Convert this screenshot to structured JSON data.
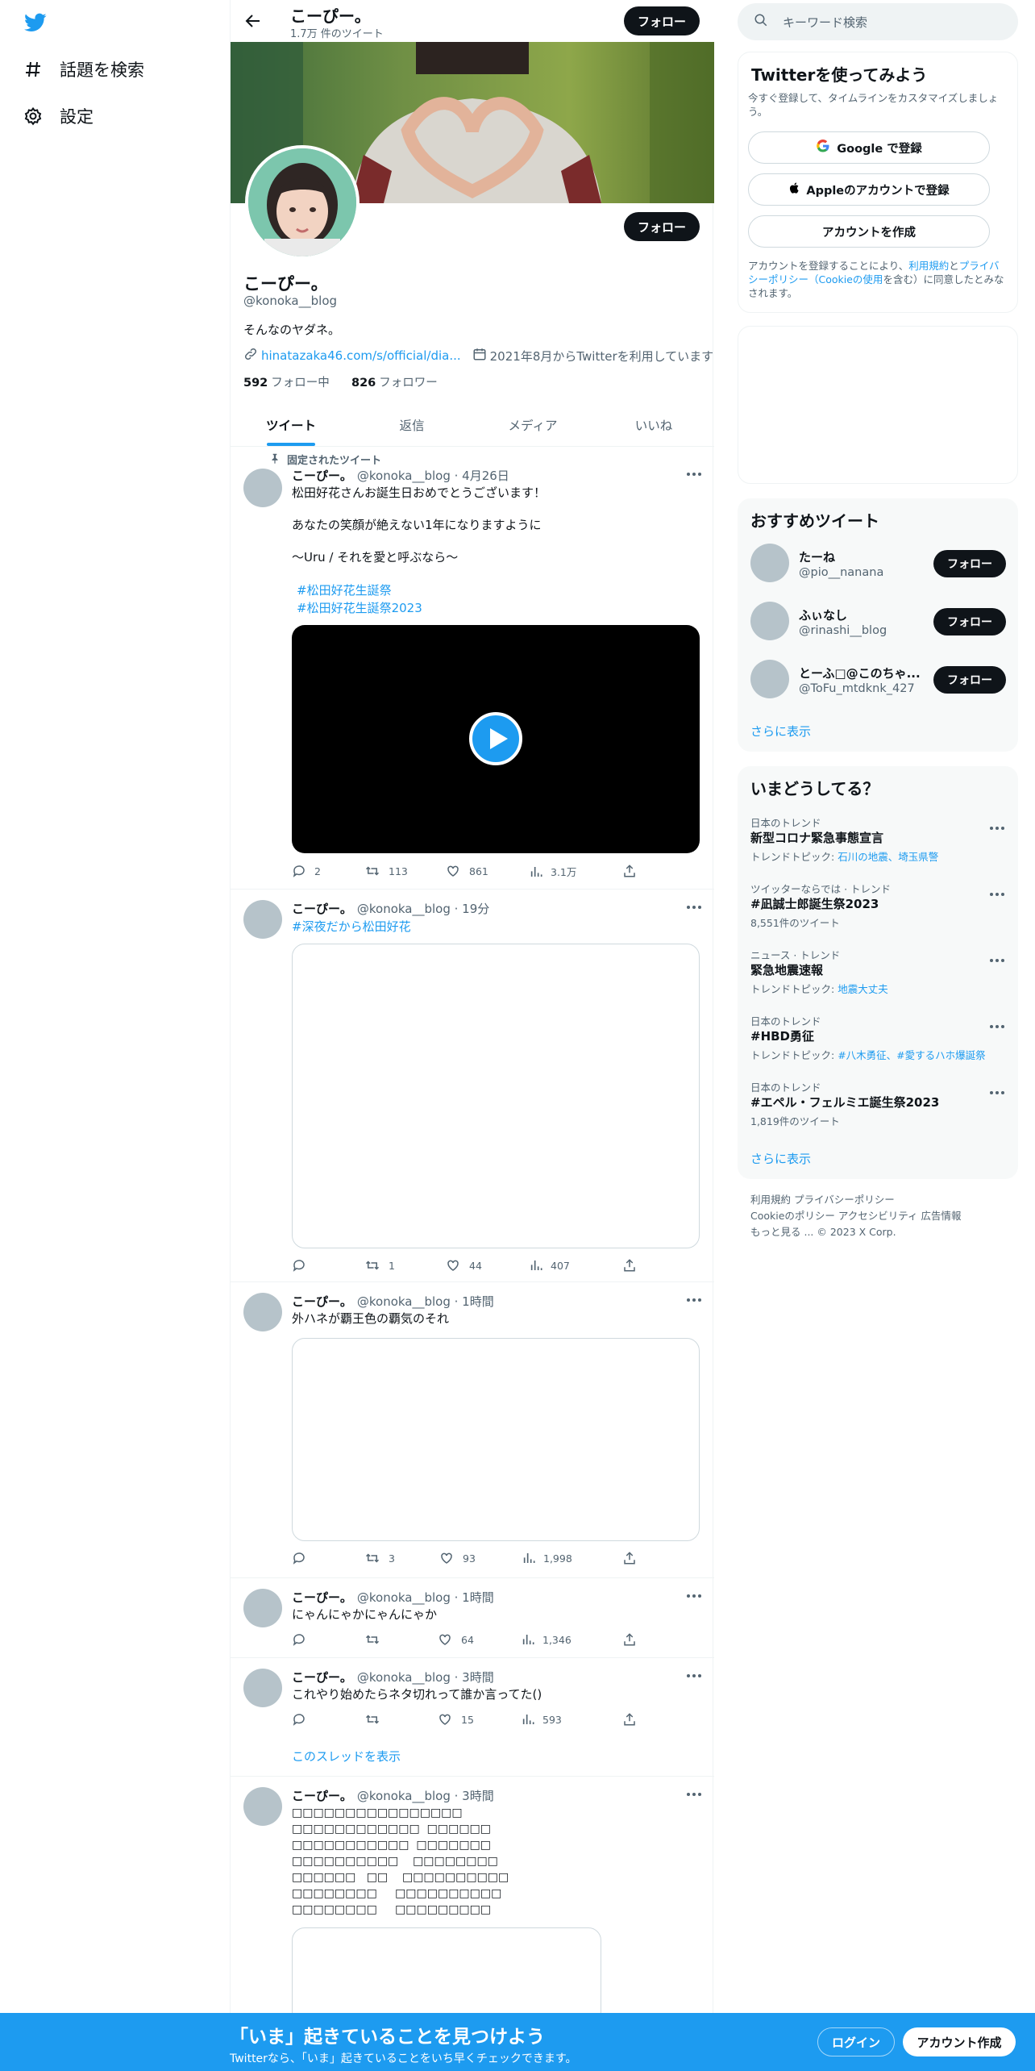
{
  "nav": {
    "logo": "twitter-bird-icon",
    "items": [
      {
        "label": "話題を検索",
        "icon": "hashtag-icon"
      },
      {
        "label": "設定",
        "icon": "gear-icon"
      }
    ]
  },
  "header": {
    "name": "こーぴー。",
    "tweet_count": "1.7万 件のツイート",
    "follow_label": "フォロー"
  },
  "profile": {
    "name": "こーぴー。",
    "handle": "@konoka__blog",
    "bio": "そんなのヤダネ。",
    "link": "hinatazaka46.com/s/official/dia...",
    "joined": "2021年8月からTwitterを利用しています",
    "following_count": "592",
    "following_label": "フォロー中",
    "followers_count": "826",
    "followers_label": "フォロワー",
    "follow_label": "フォロー"
  },
  "tabs": [
    "ツイート",
    "返信",
    "メディア",
    "いいね"
  ],
  "tweets": [
    {
      "pinned_label": "固定されたツイート",
      "name": "こーぴー。",
      "meta": "@konoka__blog · 4月26日",
      "text": "松田好花さんお誕生日おめでとうございます！\n\nあなたの笑顔が絶えない1年になりますように\n\n〜Uru / それを愛と呼ぶなら〜",
      "hashtags": [
        "#松田好花生誕祭",
        "#松田好花生誕祭2023"
      ],
      "replies": "2",
      "retweets": "113",
      "likes": "861",
      "views": "3.1万"
    },
    {
      "name": "こーぴー。",
      "meta": "@konoka__blog · 19分",
      "hashtag": "#深夜だから松田好花",
      "replies": "",
      "retweets": "1",
      "likes": "44",
      "views": "407"
    },
    {
      "name": "こーぴー。",
      "meta": "@konoka__blog · 1時間",
      "text": "外ハネが覇王色の覇気のそれ",
      "replies": "",
      "retweets": "3",
      "likes": "93",
      "views": "1,998"
    },
    {
      "name": "こーぴー。",
      "meta": "@konoka__blog · 1時間",
      "text": "にゃんにゃかにゃんにゃか",
      "replies": "",
      "retweets": "",
      "likes": "64",
      "views": "1,346"
    },
    {
      "name": "こーぴー。",
      "meta": "@konoka__blog · 3時間",
      "text": "これやり始めたらネタ切れって誰か言ってた()",
      "replies": "",
      "retweets": "",
      "likes": "15",
      "views": "593",
      "thread_label": "このスレッドを表示"
    },
    {
      "name": "こーぴー。",
      "meta": "@konoka__blog · 3時間",
      "text": "□□□□□□□□□□□□□□□□\n□□□□□□□□□□□□  □□□□□□\n□□□□□□□□□□□  □□□□□□□\n□□□□□□□□□□    □□□□□□□□\n□□□□□□   □□    □□□□□□□□□□\n□□□□□□□□     □□□□□□□□□□\n□□□□□□□□     □□□□□□□□□"
    }
  ],
  "right": {
    "search_placeholder": "キーワード検索",
    "signup": {
      "title": "Twitterを使ってみよう",
      "desc": "今すぐ登録して、タイムラインをカスタマイズしましょう。",
      "google_label": "Google で登録",
      "apple_label": "Appleのアカウントで登録",
      "create_label": "アカウントを作成",
      "terms_1": "アカウントを登録することにより、",
      "terms_link1": "利用規約",
      "terms_2": "と",
      "terms_link2": "プライバシーポリシー（Cookieの使用",
      "terms_3": "を含む）に同意したとみなされます。"
    },
    "recommended": {
      "title": "おすすめツイート",
      "users": [
        {
          "name": "たーね",
          "handle": "@pio__nanana"
        },
        {
          "name": "ふぃなし",
          "handle": "@rinashi__blog"
        },
        {
          "name": "とーふ□@このちゃ...",
          "handle": "@ToFu_mtdknk_427"
        }
      ],
      "follow_label": "フォロー",
      "show_more": "さらに表示"
    },
    "trends": {
      "title": "いまどうしてる？",
      "items": [
        {
          "category": "日本のトレンド",
          "title": "新型コロナ緊急事態宣言",
          "sub_prefix": "トレンドトピック: ",
          "sub_link": "石川の地震、埼玉県警"
        },
        {
          "category": "ツイッターならでは · トレンド",
          "title": "#凪誠士郎誕生祭2023",
          "sub_prefix": "8,551件のツイート",
          "sub_link": ""
        },
        {
          "category": "ニュース · トレンド",
          "title": "緊急地震速報",
          "sub_prefix": "トレンドトピック: ",
          "sub_link": "地震大丈夫"
        },
        {
          "category": "日本のトレンド",
          "title": "#HBD勇征",
          "sub_prefix": "トレンドトピック: ",
          "sub_link": "#八木勇征、#愛するハホ爆誕祭"
        },
        {
          "category": "日本のトレンド",
          "title": "#エペル・フェルミエ誕生祭2023",
          "sub_prefix": "1,819件のツイート",
          "sub_link": ""
        }
      ],
      "show_more": "さらに表示"
    },
    "footer": {
      "line1": "利用規約   プライバシーポリシー",
      "line2": "Cookieのポリシー   アクセシビリティ   広告情報",
      "line3": "もっと見る ...    © 2023 X Corp."
    }
  },
  "bottom": {
    "title": "「いま」起きていることを見つけよう",
    "subtitle": "Twitterなら、「いま」起きていることをいち早くチェックできます。",
    "login_label": "ログイン",
    "signup_label": "アカウント作成"
  },
  "colors": {
    "accent": "#1d9bf0",
    "dark": "#0f1419",
    "muted": "#536471"
  }
}
